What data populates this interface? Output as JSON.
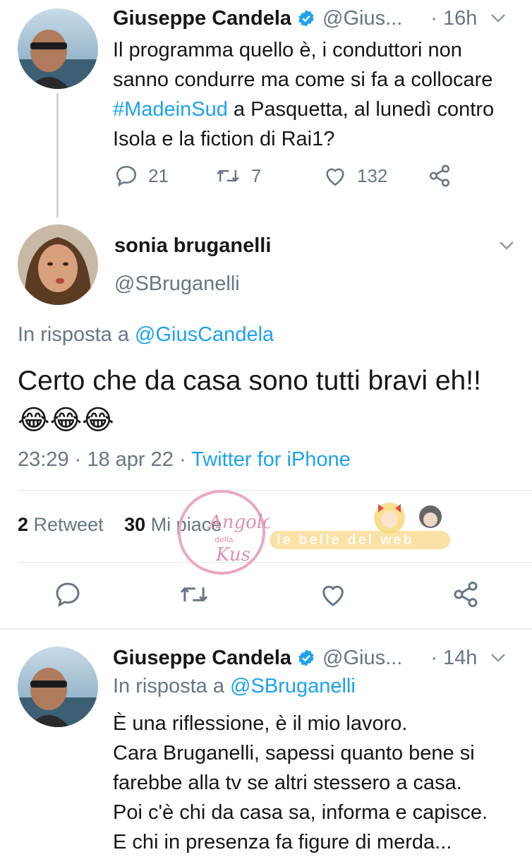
{
  "tweet1": {
    "name": "Giuseppe Candela",
    "handle": "@Gius...",
    "time": "· 16h",
    "text_before": "Il programma quello è, i conduttori non sanno condurre ma come si fa a collocare ",
    "hashtag": "#MadeinSud",
    "text_after": " a Pasquetta, al lunedì contro Isola e la fiction di Rai1?",
    "replies": "21",
    "retweets": "7",
    "likes": "132"
  },
  "tweet2": {
    "name": "sonia bruganelli",
    "handle": "@SBruganelli",
    "reply_prefix": "In risposta a",
    "reply_to": "@GiusCandela",
    "text": "Certo che da casa sono tutti bravi eh!! 😂😂😂",
    "timestamp": "23:29 · 18 apr 22 ·",
    "source": "Twitter for iPhone",
    "retweet_count": "2",
    "retweet_label": "Retweet",
    "like_count": "30",
    "like_label": "Mi piace"
  },
  "tweet3": {
    "name": "Giuseppe Candela",
    "handle": "@Gius...",
    "time": "· 14h",
    "reply_prefix": "In risposta a",
    "reply_to": "@SBruganelli",
    "lines": [
      "È una riflessione, è il mio lavoro.",
      "Cara Bruganelli, sapessi quanto bene si",
      "farebbe alla tv se altri stessero a casa.",
      "Poi c'è chi da casa sa, informa e capisce.",
      "E chi in presenza fa figure di merda..."
    ]
  },
  "watermark": {
    "stamp": "Angolo della Kus",
    "banner": "le belle del web"
  },
  "colors": {
    "link": "#1da1f2",
    "muted": "#657786",
    "text": "#14171a",
    "verified": "#1da1f2"
  }
}
